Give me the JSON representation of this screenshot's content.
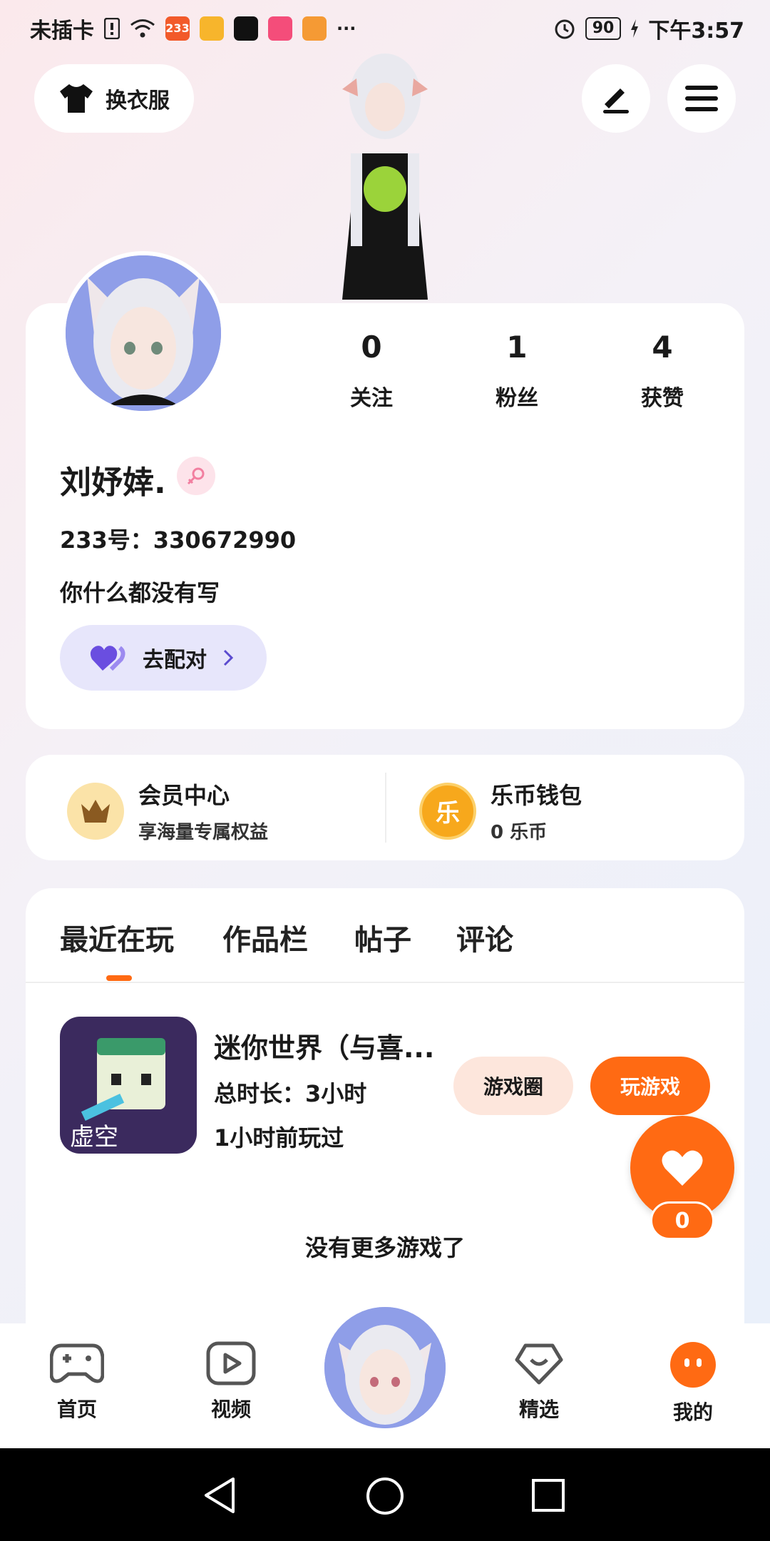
{
  "status_bar": {
    "carrier": "未插卡",
    "app_badge": "233",
    "more": "···",
    "battery": "90",
    "time": "下午3:57"
  },
  "top": {
    "dress_up_label": "换衣服"
  },
  "profile": {
    "stats": [
      {
        "value": "0",
        "label": "关注"
      },
      {
        "value": "1",
        "label": "粉丝"
      },
      {
        "value": "4",
        "label": "获赞"
      }
    ],
    "username": "刘妤婞.",
    "user_id": "233号：330672990",
    "bio": "你什么都没有写",
    "match_label": "去配对"
  },
  "wallet": {
    "member_title": "会员中心",
    "member_sub": "享海量专属权益",
    "coin_icon_text": "乐",
    "coin_title": "乐币钱包",
    "coin_sub": "0 乐币"
  },
  "tabs": [
    "最近在玩",
    "作品栏",
    "帖子",
    "评论"
  ],
  "game": {
    "icon_text": "虚空",
    "title": "迷你世界（与喜...",
    "duration": "总时长：3小时",
    "last_played": "1小时前玩过",
    "circle_btn": "游戏圈",
    "play_btn": "玩游戏"
  },
  "like_count": "0",
  "no_more": "没有更多游戏了",
  "bottom_nav": [
    {
      "label": "首页"
    },
    {
      "label": "视频"
    },
    {
      "label": "精选"
    },
    {
      "label": "我的"
    }
  ],
  "colors": {
    "accent": "#ff6a13",
    "match_bg": "#e7e6fb"
  }
}
